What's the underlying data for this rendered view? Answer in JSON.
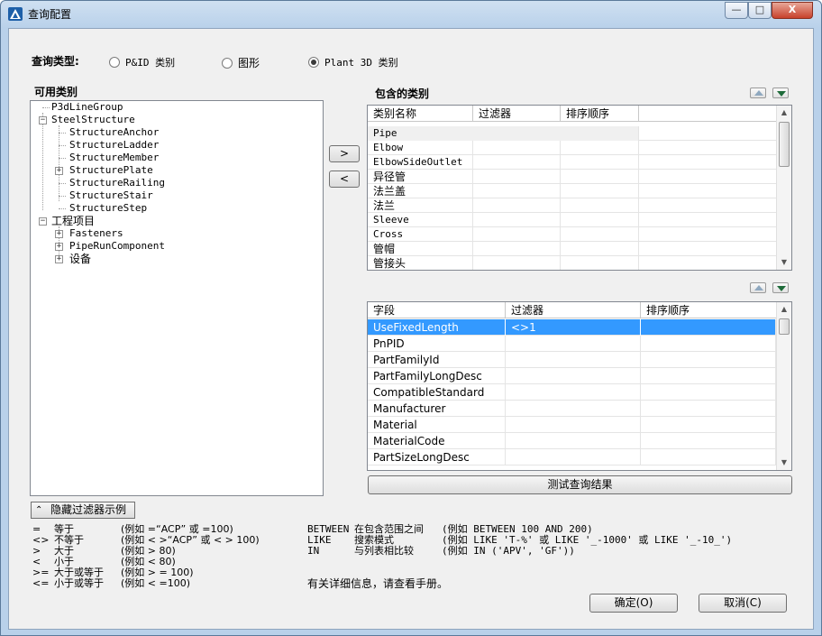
{
  "window": {
    "title": "查询配置",
    "min_glyph": "—",
    "max_glyph": "□",
    "close_glyph": "X"
  },
  "query_type": {
    "label": "查询类型:",
    "options": [
      {
        "label": "P&ID 类别",
        "selected": false
      },
      {
        "label": "图形",
        "selected": false
      },
      {
        "label": "Plant 3D 类别",
        "selected": true
      }
    ]
  },
  "available": {
    "label": "可用类别",
    "tree": [
      {
        "label": "P3dLineGroup",
        "level": 0,
        "expander": "none"
      },
      {
        "label": "SteelStructure",
        "level": 0,
        "expander": "-"
      },
      {
        "label": "StructureAnchor",
        "level": 1,
        "expander": "none"
      },
      {
        "label": "StructureLadder",
        "level": 1,
        "expander": "none"
      },
      {
        "label": "StructureMember",
        "level": 1,
        "expander": "none"
      },
      {
        "label": "StructurePlate",
        "level": 1,
        "expander": "+"
      },
      {
        "label": "StructureRailing",
        "level": 1,
        "expander": "none"
      },
      {
        "label": "StructureStair",
        "level": 1,
        "expander": "none"
      },
      {
        "label": "StructureStep",
        "level": 1,
        "expander": "none"
      },
      {
        "label": "工程项目",
        "level": 0,
        "expander": "-"
      },
      {
        "label": "Fasteners",
        "level": 1,
        "expander": "+"
      },
      {
        "label": "PipeRunComponent",
        "level": 1,
        "expander": "+"
      },
      {
        "label": "设备",
        "level": 1,
        "expander": "+"
      }
    ]
  },
  "transfer": {
    "add": ">",
    "remove": "<"
  },
  "included": {
    "label": "包含的类别",
    "columns": [
      "类别名称",
      "过滤器",
      "排序顺序"
    ],
    "rows": [
      {
        "name": "Pipe",
        "filter": "",
        "order": ""
      },
      {
        "name": "Elbow",
        "filter": "",
        "order": ""
      },
      {
        "name": "ElbowSideOutlet",
        "filter": "",
        "order": ""
      },
      {
        "name": "异径管",
        "filter": "",
        "order": ""
      },
      {
        "name": "法兰盖",
        "filter": "",
        "order": ""
      },
      {
        "name": "法兰",
        "filter": "",
        "order": ""
      },
      {
        "name": "Sleeve",
        "filter": "",
        "order": ""
      },
      {
        "name": "Cross",
        "filter": "",
        "order": ""
      },
      {
        "name": "管帽",
        "filter": "",
        "order": ""
      },
      {
        "name": "管接头",
        "filter": "",
        "order": ""
      }
    ]
  },
  "fields": {
    "columns": [
      "字段",
      "过滤器",
      "排序顺序"
    ],
    "rows": [
      {
        "name": "UseFixedLength",
        "filter": "<>1",
        "order": "",
        "selected": true
      },
      {
        "name": "PnPID",
        "filter": "",
        "order": ""
      },
      {
        "name": "PartFamilyId",
        "filter": "",
        "order": ""
      },
      {
        "name": "PartFamilyLongDesc",
        "filter": "",
        "order": ""
      },
      {
        "name": "CompatibleStandard",
        "filter": "",
        "order": ""
      },
      {
        "name": "Manufacturer",
        "filter": "",
        "order": ""
      },
      {
        "name": "Material",
        "filter": "",
        "order": ""
      },
      {
        "name": "MaterialCode",
        "filter": "",
        "order": ""
      },
      {
        "name": "PartSizeLongDesc",
        "filter": "",
        "order": ""
      }
    ]
  },
  "test_button": "测试查询结果",
  "hide_examples_button": "隐藏过滤器示例",
  "examples_left": [
    {
      "op": "=",
      "name": "等于",
      "example": "(例如 =“ACP” 或 =100)"
    },
    {
      "op": "<>",
      "name": "不等于",
      "example": "(例如 < >“ACP” 或 < > 100)"
    },
    {
      "op": ">",
      "name": "大于",
      "example": "(例如 > 80)"
    },
    {
      "op": "<",
      "name": "小于",
      "example": "(例如 < 80)"
    },
    {
      "op": ">=",
      "name": "大于或等于",
      "example": "(例如 > = 100)"
    },
    {
      "op": "<=",
      "name": "小于或等于",
      "example": "(例如 < =100)"
    }
  ],
  "examples_right": [
    {
      "op": "BETWEEN",
      "name": "在包含范围之间",
      "example": "(例如 BETWEEN 100 AND 200)"
    },
    {
      "op": "LIKE",
      "name": "搜索模式",
      "example": "(例如 LIKE 'T-%' 或 LIKE '_-1000' 或 LIKE '_-10_')"
    },
    {
      "op": "IN",
      "name": "与列表相比较",
      "example": "(例如 IN ('APV', 'GF'))"
    }
  ],
  "manual_note": "有关详细信息，请查看手册。",
  "ok_button": "确定(O)",
  "cancel_button": "取消(C)",
  "colors": {
    "selection": "#3399ff",
    "title_gradient": "#cfe0f1",
    "dialog_bg": "#f0f0f0"
  }
}
